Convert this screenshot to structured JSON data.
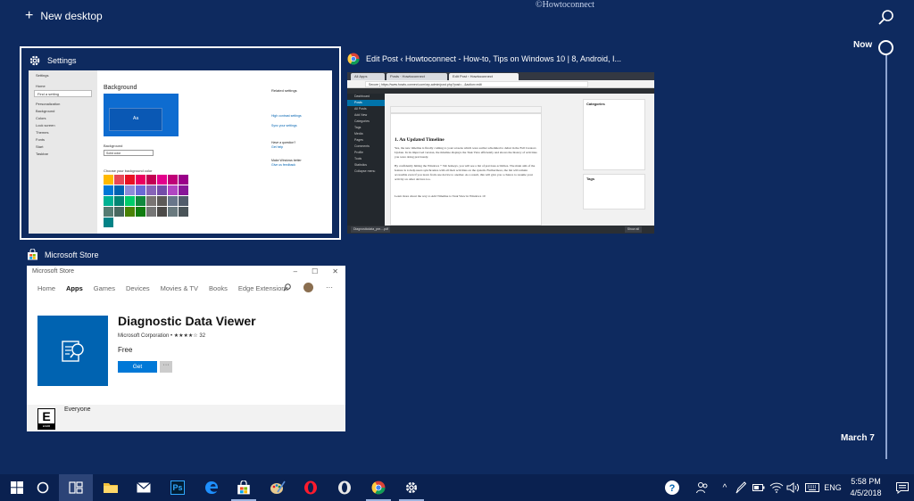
{
  "top": {
    "new_desktop_label": "New desktop",
    "watermark": "©Howtoconnect"
  },
  "timeline": {
    "now_label": "Now",
    "date_label": "March 7"
  },
  "windows": {
    "settings": {
      "title": "Settings",
      "thumb": {
        "header": "Settings",
        "sidebar": [
          "Home",
          "Find a setting",
          "Personalization",
          "Background",
          "Colors",
          "Lock screen",
          "Themes",
          "Fonts",
          "Start",
          "Taskbar"
        ],
        "heading": "Background",
        "preview_text": "Aa",
        "background_label": "Background",
        "background_value": "Solid color",
        "color_label": "Choose your background color",
        "right_panel": [
          "Related settings",
          "High contrast settings",
          "Sync your settings",
          "Have a question?",
          "Get help",
          "Make Windows better",
          "Give us feedback"
        ]
      }
    },
    "chrome": {
      "title": "Edit Post ‹ Howtoconnect - How-to, Tips on Windows 10 | 8, Android, I...",
      "thumb": {
        "tab1": "All Apps",
        "tab2": "Posts · Howtoconnect",
        "tab3": "Edit Post ‹ Howtoconnect",
        "url": "Secure | https://www.howto-connect.com/wp-admin/post.php?post=...&action=edit",
        "admin_menu": [
          "Dashboard",
          "Posts",
          "All Posts",
          "Add New",
          "Categories",
          "Tags",
          "Media",
          "Pages",
          "Comments",
          "Profile",
          "Tools",
          "Statistics",
          "Collapse menu"
        ],
        "heading": "1. An Updated Timeline",
        "para1": "Yes, the new timeline is finally coming to your screens which were earlier scheduled to debut in the Fall Creators Update. In its improved version, the timeline displays the Task View efficiently and shows the history of activities you were doing previously.",
        "para2": "By confidently hitting the Windows + Tab hotkeys, you will see a list of previous activities. The main aim of the feature is to help users synchronize with all their activities on the system. Furthermore, the list will remain accessible even if you leave from one device to another. As a result, this will give you a chance to resume your activity on other devices too.",
        "para3": "Learn more about the way to Add Timeline to Task View in Windows 10",
        "categories_title": "Categories",
        "tags_title": "Tags",
        "download_item": "Diagnosticdata_pre....pdf",
        "show_all": "Show all"
      }
    },
    "store": {
      "title": "Microsoft Store",
      "thumb": {
        "titlebar": "Microsoft Store",
        "nav": [
          "Home",
          "Apps",
          "Games",
          "Devices",
          "Movies & TV",
          "Books",
          "Edge Extensions"
        ],
        "selected_nav": "Apps",
        "app_name": "Diagnostic Data Viewer",
        "publisher": "Microsoft Corporation • ★★★★☆ 32",
        "price": "Free",
        "get_label": "Get",
        "more_label": "···",
        "rating_letter": "E",
        "rating_org": "ESRB",
        "rating_text": "Everyone"
      }
    }
  },
  "taskbar": {
    "apps": [
      "start-icon",
      "cortana-icon",
      "task-view-icon",
      "file-explorer-icon",
      "mail-icon",
      "photoshop-icon",
      "edge-icon",
      "store-icon",
      "paint-icon",
      "opera-icon",
      "opera-beta-icon",
      "chrome-icon",
      "settings-icon"
    ],
    "photoshop_label": "Ps",
    "language": "ENG",
    "time": "5:58 PM",
    "date": "4/5/2018"
  },
  "colors": {
    "background": "#0e2a5f",
    "taskbar": "#0a2150",
    "accent": "#0078d7",
    "swatches": [
      "#ffb900",
      "#e74856",
      "#e81123",
      "#ea005e",
      "#c30052",
      "#e3008c",
      "#bf0077",
      "#9a0089",
      "#0078d7",
      "#0063b1",
      "#8e8cd8",
      "#6b69d6",
      "#8764b8",
      "#744da9",
      "#b146c2",
      "#881798",
      "#00b294",
      "#018574",
      "#00cc6a",
      "#10893e",
      "#7a7574",
      "#5d5a58",
      "#68768a",
      "#515c6b",
      "#567c73",
      "#486860",
      "#498205",
      "#107c10",
      "#767676",
      "#4c4a48",
      "#69797e",
      "#4a5459",
      "#038387"
    ]
  }
}
